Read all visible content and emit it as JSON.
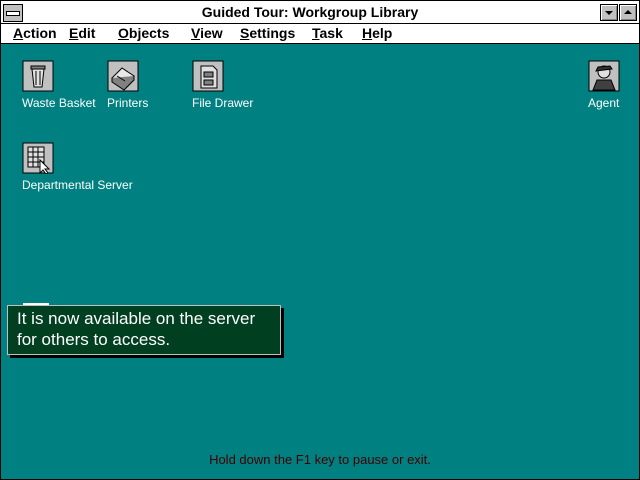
{
  "window": {
    "title": "Guided Tour: Workgroup Library"
  },
  "menu": [
    "Action",
    "Edit",
    "Objects",
    "View",
    "Settings",
    "Task",
    "Help"
  ],
  "desktop_icons": [
    {
      "name": "waste-basket-icon",
      "label": "Waste Basket"
    },
    {
      "name": "printers-icon",
      "label": "Printers"
    },
    {
      "name": "file-drawer-icon",
      "label": "File Drawer"
    },
    {
      "name": "agent-icon",
      "label": "Agent"
    },
    {
      "name": "departmental-server-icon",
      "label": "Departmental Server"
    }
  ],
  "tour_message": {
    "line1": "It is now available on the server",
    "line2": "for others to access."
  },
  "status_hint": "Hold down the F1 key to pause or exit."
}
